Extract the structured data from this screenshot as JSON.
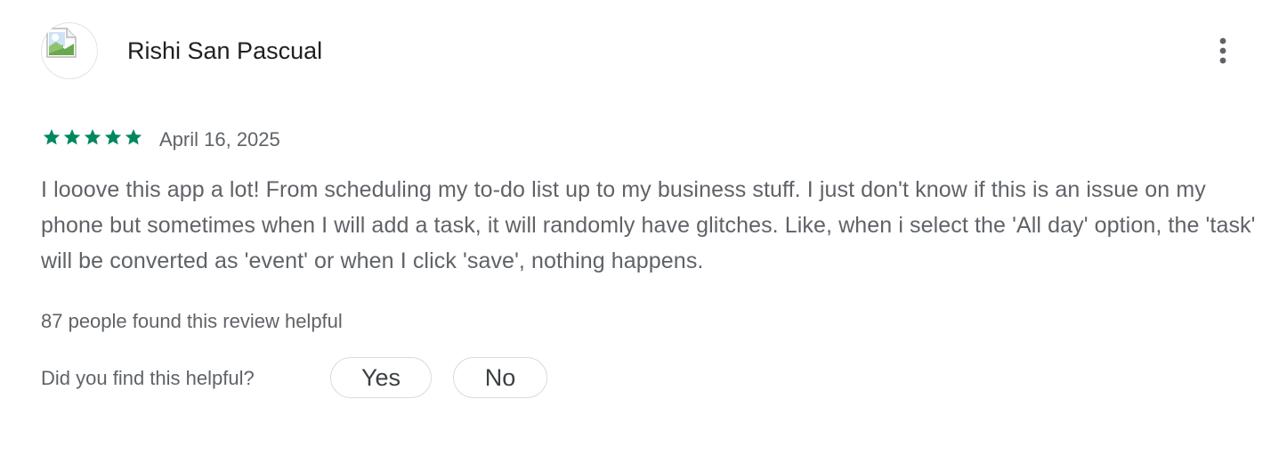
{
  "review": {
    "author": "Rishi San Pascual",
    "avatar_icon": "broken-image-icon",
    "more_icon": "more-vert-icon",
    "rating": 5,
    "rating_max": 5,
    "star_color": "#01875f",
    "date": "April 16, 2025",
    "text": "I looove this app a lot! From scheduling my to-do list up to my business stuff. I just don't know if this is an issue on my phone but sometimes when I will add a task, it will randomly have glitches. Like, when i select the 'All day' option, the 'task' will be converted as 'event' or when I click 'save', nothing happens.",
    "helpful_count_text": "87 people found this review helpful",
    "feedback": {
      "question": "Did you find this helpful?",
      "yes_label": "Yes",
      "no_label": "No"
    }
  }
}
